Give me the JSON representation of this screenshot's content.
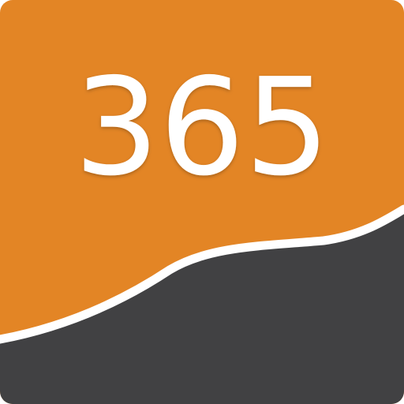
{
  "icon": {
    "number": "365",
    "colors": {
      "top": "#E38525",
      "bottom": "#414143",
      "divider": "#FFFFFF",
      "text": "#FFFFFF"
    }
  }
}
